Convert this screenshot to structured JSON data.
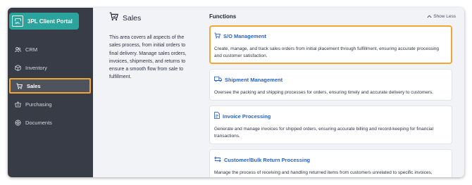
{
  "brand": {
    "name": "3PL Client Portal",
    "logo_text": "3PL"
  },
  "sidebar": {
    "items": [
      {
        "label": "CRM",
        "icon": "users-icon"
      },
      {
        "label": "Inventory",
        "icon": "box-icon"
      },
      {
        "label": "Sales",
        "icon": "cart-icon",
        "active": true
      },
      {
        "label": "Purchasing",
        "icon": "purchase-icon"
      },
      {
        "label": "Documents",
        "icon": "documents-icon"
      }
    ]
  },
  "intro": {
    "title": "Sales",
    "description": "This area covers all aspects of the sales process, from initial orders to final delivery. Manage sales orders, invoices, shipments, and returns to ensure a smooth flow from sale to fulfillment."
  },
  "functions": {
    "title": "Functions",
    "toggle_label": "Show Less",
    "cards": [
      {
        "title": "S/O Management",
        "description": "Create, manage, and track sales orders from initial placement through fulfillment, ensuring accurate processing and customer satisfaction.",
        "icon": "order-icon",
        "highlighted": true
      },
      {
        "title": "Shipment Management",
        "description": "Oversee the packing and shipping processes for orders, ensuring timely and accurate delivery to customers.",
        "icon": "truck-icon"
      },
      {
        "title": "Invoice Processing",
        "description": "Generate and manage invoices for shipped orders, ensuring accurate billing and record-keeping for financial transactions.",
        "icon": "invoice-icon"
      },
      {
        "title": "Customer/Bulk Return Processing",
        "description": "Manage the process of receiving and handling returned items from customers unrelated to specific invoices, ensuring proper documentation and resolution.",
        "icon": "return-icon"
      }
    ]
  },
  "colors": {
    "sidebar_bg": "#373c46",
    "brand": "#2aa49c",
    "highlight": "#f2a735",
    "link": "#2b62c6"
  }
}
